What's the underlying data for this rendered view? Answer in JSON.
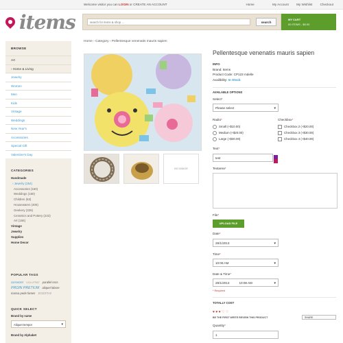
{
  "topbar": {
    "welcome_prefix": "Welcome visitor you can ",
    "login": "LOGIN",
    "or": " or ",
    "create_account": "CREATE AN ACCOUNT",
    "links": [
      "Home",
      "My Account",
      "My Wishlist",
      "Checkout"
    ]
  },
  "logo": {
    "text": "items"
  },
  "search": {
    "placeholder": "search for items & shop ...",
    "button": "search"
  },
  "cart": {
    "label": "MY CART",
    "summary": "00 ITEMS - $0.00"
  },
  "sidebar": {
    "browse_title": "BROWSE",
    "browse_items": [
      "Art",
      "Home & Living",
      "Jewelry",
      "Women",
      "Men",
      "Kids",
      "Vintage",
      "Weddings",
      "New Year's",
      "Accessories",
      "Special Gift",
      "Valentine's Day"
    ],
    "categories_title": "CATEGORIES",
    "categories": [
      "Handmade",
      "Jewelry (254)",
      "Accessories (160)",
      "Weddings (160)",
      "Children (63)",
      "Housewares (406)",
      "Geekery (326)",
      "Ceramics and Pottery (223)",
      "Art (156)",
      "Vintage",
      "Jewelry",
      "Supplies",
      "Home Decor"
    ],
    "tags_title": "POPULAR TAGS",
    "tags": [
      "consectet",
      "VOLUTPAT",
      "parallel eros",
      "PROIN PRETIUM",
      "aliquet lobore",
      "massa pede fames",
      "EGESTAS"
    ],
    "quick_title": "QUICK SELECT",
    "brand_label": "Brand by name",
    "brand_value": "Aliquet tempor",
    "alpha_label": "Brand by Alphabet"
  },
  "breadcrumb": "Home  ›  Category  ›  Pellentesque venenatis mauris sapien",
  "product": {
    "title": "Pellentesque venenatis mauris sapien",
    "info_title": "INFO",
    "brand": "Brand: Items",
    "code": "Product Code: CP123 mdelle",
    "availability_label": "Availibility: ",
    "availability": "In Stock",
    "no_image": "NO IMAGE"
  },
  "options": {
    "title": "AVAILABLE OPTIONS",
    "select_label": "Select",
    "select_value": "Please select",
    "radio_label": "Radio",
    "radios": [
      "Small (+$10.00)",
      "Medium (+$20.00)",
      "Large (+$30.00)"
    ],
    "checkbox_label": "Checkbox",
    "checkboxes": [
      "Checkbox 2 (+$20.00)",
      "Checkbox 3 (+$30.00)",
      "Checkbox 4 (+$40.00)"
    ],
    "text_label": "Text",
    "text_value": "test",
    "textarea_label": "Textarea",
    "file_label": "File",
    "upload_button": "UPLOAD FILE",
    "date_label": "Date",
    "date_value": "28/1/2013",
    "time_label": "Time",
    "time_value": "10:06 AM",
    "datetime_label": "Date & Time",
    "datetime_date": "28/1/2013",
    "datetime_time": "10:08 AM",
    "required_note": "* Required"
  },
  "total": {
    "title": "TOTALLY COST",
    "hearts": "♥ ♥ ♥ ♡ ♡",
    "review": "BE THE FIRST WRITE REVIEW THIS PRODUCT",
    "share": "SHARE",
    "quantity_label": "Quantity",
    "quantity_value": "1"
  }
}
